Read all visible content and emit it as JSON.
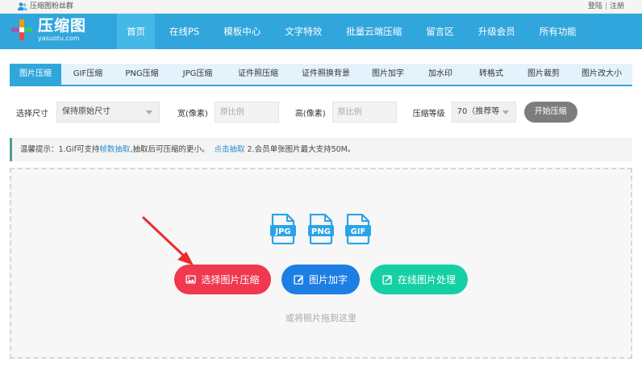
{
  "topbar": {
    "fans_text": "压缩图粉丝群",
    "login": "登陆",
    "separator": "|",
    "register": "注册"
  },
  "logo": {
    "name_cn": "压缩图",
    "domain": "yasuotu.com"
  },
  "nav": [
    {
      "label": "首页",
      "active": true
    },
    {
      "label": "在线PS"
    },
    {
      "label": "模板中心"
    },
    {
      "label": "文字特效"
    },
    {
      "label": "批量云端压缩"
    },
    {
      "label": "留言区"
    },
    {
      "label": "升级会员"
    },
    {
      "label": "所有功能"
    }
  ],
  "tools": [
    {
      "label": "图片压缩",
      "active": true
    },
    {
      "label": "GIF压缩"
    },
    {
      "label": "PNG压缩"
    },
    {
      "label": "JPG压缩"
    },
    {
      "label": "证件照压缩"
    },
    {
      "label": "证件照换背景"
    },
    {
      "label": "图片加字"
    },
    {
      "label": "加水印"
    },
    {
      "label": "转格式"
    },
    {
      "label": "图片裁剪"
    },
    {
      "label": "图片改大小"
    }
  ],
  "options": {
    "size_label": "选择尺寸",
    "size_value": "保持原始尺寸",
    "width_label": "宽(像素)",
    "width_placeholder": "原比例",
    "height_label": "高(像素)",
    "height_placeholder": "原比例",
    "level_label": "压缩等级",
    "level_value": "70（推荐等",
    "start_button": "开始压缩"
  },
  "tip": {
    "prefix": "温馨提示：1.Gif可支持",
    "link1": "帧数抽取",
    "middle": ",抽取后可压缩的更小。",
    "link2": "点击抽取",
    "suffix": " 2.会员单张图片最大支持50M。"
  },
  "dropzone": {
    "formats": [
      "JPG",
      "PNG",
      "GIF"
    ],
    "buttons": {
      "select": "选择图片压缩",
      "addtext": "图片加字",
      "online": "在线图片处理"
    },
    "hint": "或将照片拖到这里"
  },
  "colors": {
    "header": "#31a6dc",
    "nav_active": "#45b8ea",
    "select_button": "#f0384f",
    "addtext_button": "#1d7fe3",
    "online_button": "#15d0a5",
    "format_icon": "#2aa4e8",
    "arrow": "#ee2b2b"
  }
}
